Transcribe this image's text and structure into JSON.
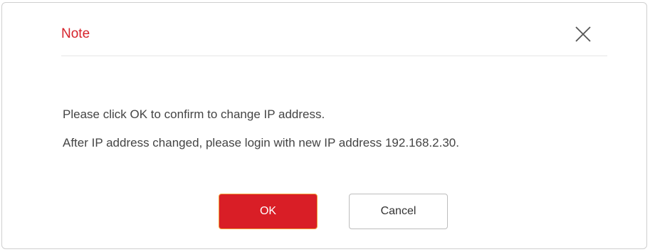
{
  "dialog": {
    "title": "Note",
    "close_icon": "close-icon",
    "messages": [
      "Please click OK to confirm to change IP address.",
      "After IP address changed, please login with new IP address 192.168.2.30."
    ],
    "ok_label": "OK",
    "cancel_label": "Cancel"
  },
  "colors": {
    "title": "#d6232b",
    "ok_button": "#d91e26",
    "ok_border": "#f2a13a",
    "text": "#444444"
  }
}
